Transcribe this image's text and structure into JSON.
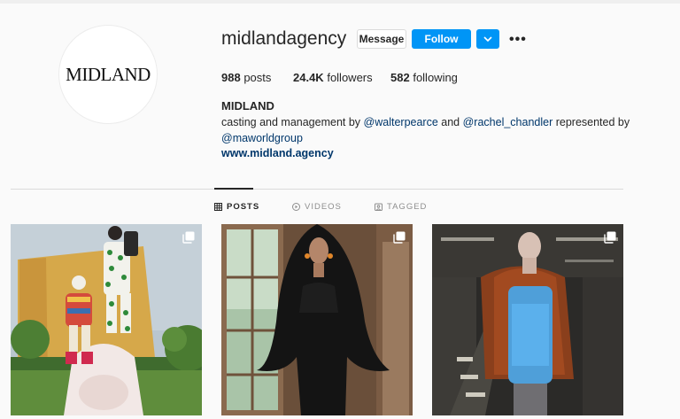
{
  "profile": {
    "avatar_text": "MIDLAND",
    "username": "midlandagency",
    "message_label": "Message",
    "follow_label": "Follow",
    "posts_count": "988",
    "posts_label": "posts",
    "followers_count": "24.4K",
    "followers_label": "followers",
    "following_count": "582",
    "following_label": "following",
    "full_name": "MIDLAND",
    "bio_prefix": "casting and management by ",
    "mention1": "@walterpearce",
    "bio_and": " and ",
    "mention2": "@rachel_chandler",
    "bio_represented": " represented by",
    "mention3": "@maworldgroup",
    "website": "www.midland.agency"
  },
  "tabs": [
    {
      "label": "POSTS",
      "icon": "grid-icon",
      "active": true
    },
    {
      "label": "VIDEOS",
      "icon": "play-icon",
      "active": false
    },
    {
      "label": "TAGGED",
      "icon": "tag-icon",
      "active": false
    }
  ],
  "posts": [
    {
      "icon": "multiple-photos-icon"
    },
    {
      "icon": "multiple-photos-icon"
    },
    {
      "icon": "multiple-photos-icon"
    }
  ],
  "colors": {
    "follow_button": "#0095f6",
    "link": "#00376b",
    "text": "#262626",
    "muted": "#8e8e8e"
  }
}
